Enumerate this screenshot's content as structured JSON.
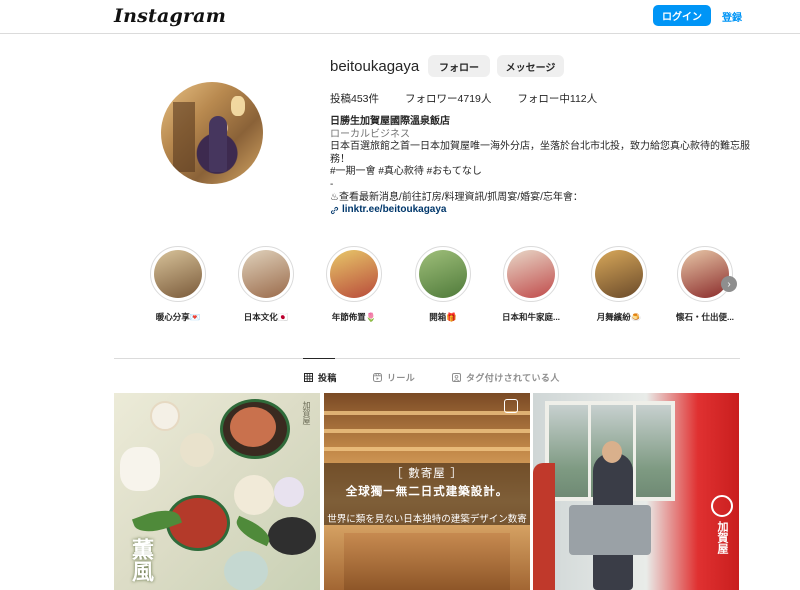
{
  "nav": {
    "logo": "Instagram",
    "login": "ログイン",
    "signup": "登録"
  },
  "profile": {
    "username": "beitoukagaya",
    "follow": "フォロー",
    "message": "メッセージ",
    "stats": {
      "posts": "投稿453件",
      "followers": "フォロワー4719人",
      "following": "フォロー中112人"
    },
    "bio": {
      "name": "日勝生加賀屋國際溫泉飯店",
      "category": "ローカルビジネス",
      "line1": "日本百選旅館之首一日本加賀屋唯一海外分店，坐落於台北市北投，致力給您真心款待的難忘服",
      "line2": "務！",
      "line3": "#一期一會 #真心款待 #おもてなし",
      "line4": "-",
      "line5": "♨︎查看最新消息/前往訂房/料理資訊/抓周宴/婚宴/忘年會：",
      "link": "linktr.ee/beitoukagaya"
    }
  },
  "highlights": [
    {
      "label": "暖心分享💌",
      "colors": [
        "#7a5a3a",
        "#d8c39a"
      ]
    },
    {
      "label": "日本文化🇯🇵",
      "colors": [
        "#9a6a4a",
        "#e0d2bc"
      ]
    },
    {
      "label": "年節佈置🌷",
      "colors": [
        "#b84a3a",
        "#e8c86a"
      ]
    },
    {
      "label": "開箱🎁",
      "colors": [
        "#4f7a3a",
        "#9fbf7a"
      ]
    },
    {
      "label": "日本和牛家庭...",
      "colors": [
        "#c04a4a",
        "#e8d8c8"
      ]
    },
    {
      "label": "月舞繽紛🍮",
      "colors": [
        "#6a4a2a",
        "#d8a85a"
      ]
    },
    {
      "label": "懐石・仕出便...",
      "colors": [
        "#8a2a2a",
        "#e8c8a8"
      ]
    }
  ],
  "tabs": [
    {
      "label": "投稿",
      "icon": "grid-icon"
    },
    {
      "label": "リール",
      "icon": "reels-icon"
    },
    {
      "label": "タグ付けされている人",
      "icon": "tagged-icon"
    }
  ],
  "posts": {
    "p1": {
      "calligraphy": "薫風",
      "brand": "加賀屋"
    },
    "p2": {
      "title": "［ 數寄屋 ］",
      "subtitle": "全球獨一無二日式建築設計。",
      "caption": "世界に類を見ない日本独特の建築デザイン数寄"
    },
    "p3": {
      "seal": "加賀屋"
    }
  },
  "colors": {
    "accent": "#0095f6",
    "link": "#00376b"
  }
}
